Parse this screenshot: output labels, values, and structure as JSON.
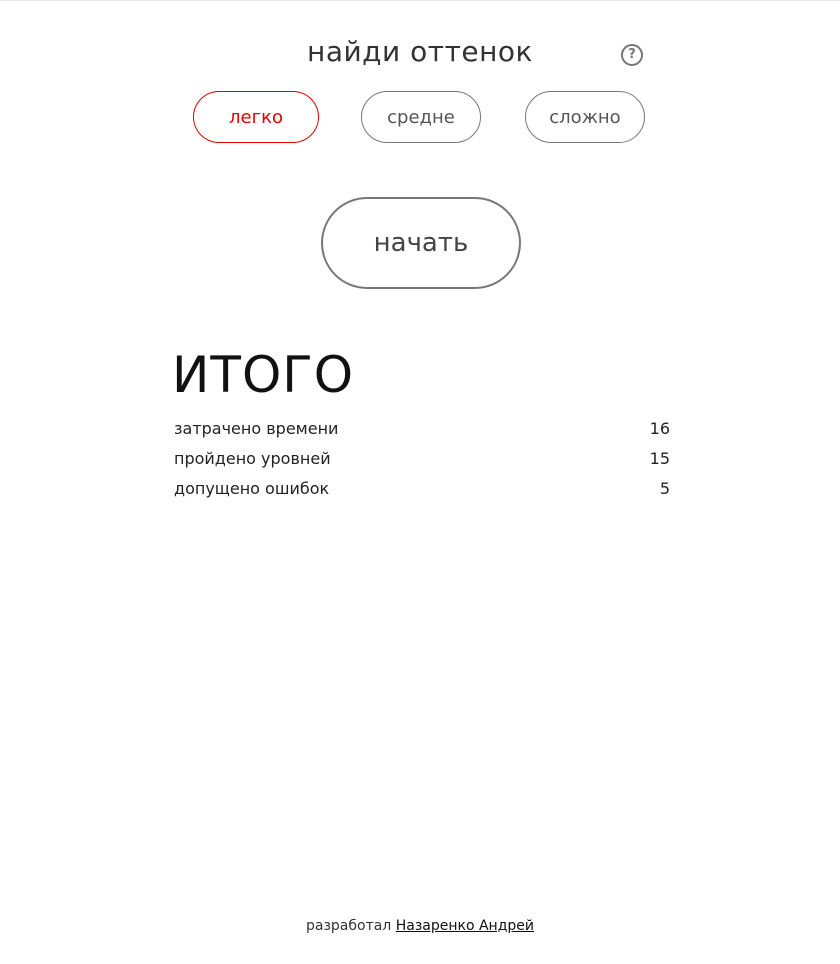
{
  "header": {
    "title": "найди оттенок",
    "help_icon": "?"
  },
  "levels": {
    "easy": "легко",
    "medium": "средне",
    "hard": "сложно",
    "selected": "легко"
  },
  "start_label": "начать",
  "results": {
    "heading": "ИТОГО",
    "rows": [
      {
        "label": "затрачено времени",
        "value": "16"
      },
      {
        "label": "пройдено уровней",
        "value": "15"
      },
      {
        "label": "допущено ошибок",
        "value": "5"
      }
    ]
  },
  "footer": {
    "prefix": "разработал",
    "author": "Назаренко Андрей"
  },
  "colors": {
    "accent_selected": "#e00000",
    "border": "#777777"
  }
}
